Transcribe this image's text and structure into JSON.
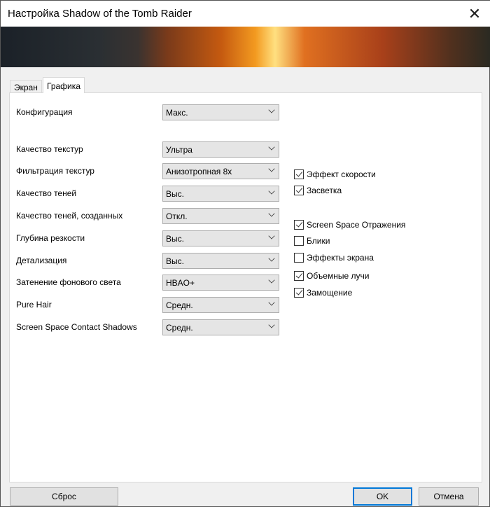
{
  "window": {
    "title": "Настройка Shadow of the Tomb Raider"
  },
  "tabs": [
    {
      "label": "Экран",
      "active": false
    },
    {
      "label": "Графика",
      "active": true
    }
  ],
  "config": {
    "label": "Конфигурация",
    "value": "Макс."
  },
  "settings": [
    {
      "label": "Качество текстур",
      "value": "Ультра"
    },
    {
      "label": "Фильтрация текстур",
      "value": "Анизотропная 8x"
    },
    {
      "label": "Качество теней",
      "value": "Выс."
    },
    {
      "label": "Качество теней, созданных",
      "value": "Откл."
    },
    {
      "label": "Глубина резкости",
      "value": "Выс."
    },
    {
      "label": "Детализация",
      "value": "Выс."
    },
    {
      "label": "Затенение фонового света",
      "value": "HBAO+"
    },
    {
      "label": "Pure Hair",
      "value": "Средн."
    },
    {
      "label": "Screen Space Contact Shadows",
      "value": "Средн."
    }
  ],
  "checkboxes": [
    {
      "label": "Эффект скорости",
      "checked": true
    },
    {
      "label": "Засветка",
      "checked": true
    },
    {
      "label": "Screen Space Отражения",
      "checked": true
    },
    {
      "label": "Блики",
      "checked": false
    },
    {
      "label": "Эффекты экрана",
      "checked": false
    },
    {
      "label": "Объемные лучи",
      "checked": true
    },
    {
      "label": "Замощение",
      "checked": true
    }
  ],
  "buttons": {
    "reset": "Сброс",
    "ok": "OK",
    "cancel": "Отмена"
  }
}
